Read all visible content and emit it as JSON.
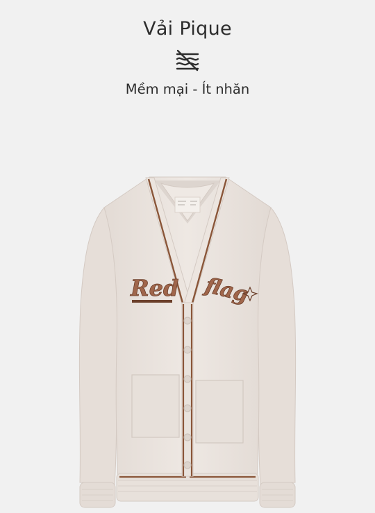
{
  "header": {
    "title": "Vải Pique",
    "icon": "wrinkle-free-fabric-icon",
    "subtitle": "Mềm mại - Ít nhăn"
  },
  "product": {
    "image": "cream-cardigan",
    "embroidery_left": "Red",
    "embroidery_right": "flag",
    "colors": {
      "body": "#ebe4df",
      "trim": "#8a5639",
      "embroidery": "#a0664b"
    }
  }
}
